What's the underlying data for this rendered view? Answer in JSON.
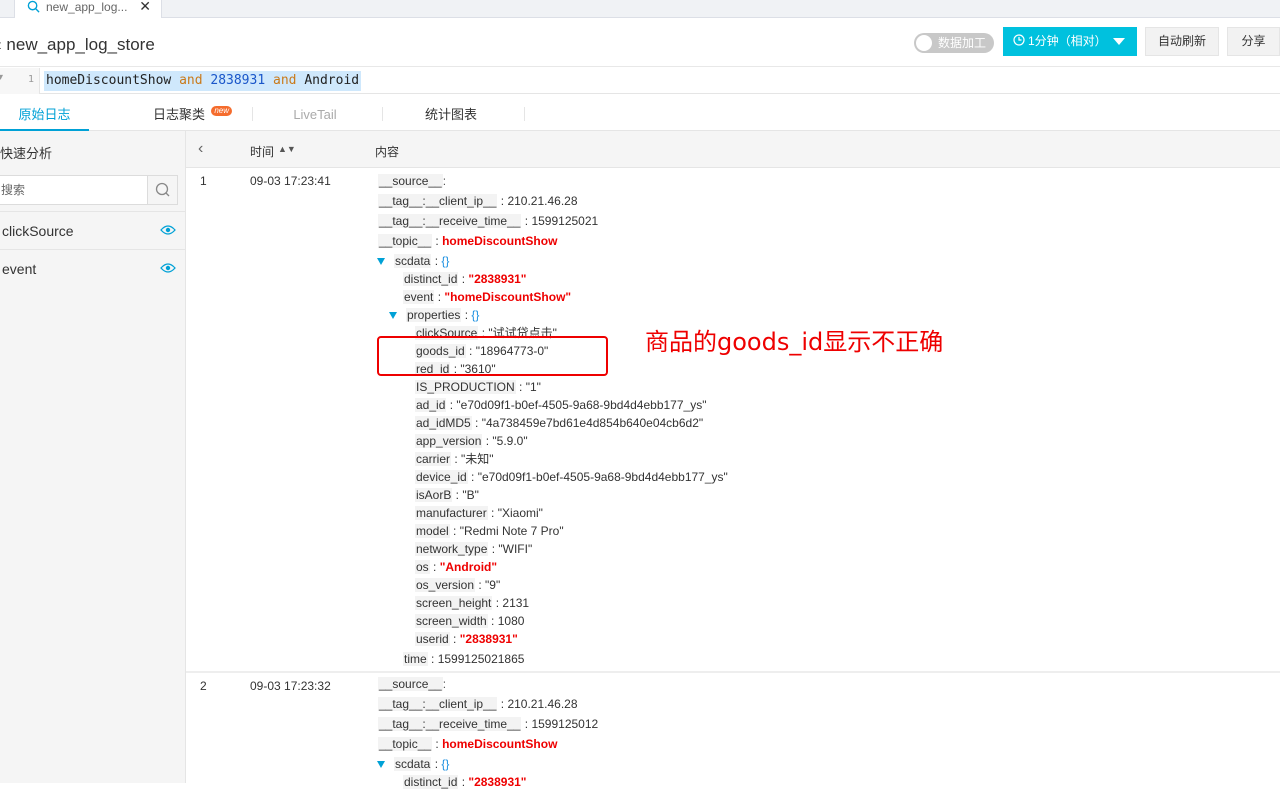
{
  "tab": {
    "label": "new_app_log...",
    "close": "✕"
  },
  "header": {
    "store_name": "new_app_log_store",
    "back": "‹"
  },
  "toolbar": {
    "data_process_label": "数据加工",
    "time_label": "1分钟（相对）",
    "auto_refresh_label": "自动刷新",
    "share_label": "分享"
  },
  "query": {
    "line_number": "1",
    "fold": "▾",
    "tokens": [
      "homeDiscountShow",
      "and",
      "2838931",
      "and",
      "Android"
    ]
  },
  "result_tabs": [
    {
      "label": "原始日志"
    },
    {
      "label": "日志聚类",
      "badge": "new"
    },
    {
      "label": "LiveTail"
    },
    {
      "label": "统计图表"
    }
  ],
  "sidebar": {
    "title": "快速分析",
    "search_placeholder": "搜索",
    "fields": [
      "clickSource",
      "event"
    ]
  },
  "table": {
    "collapse_icon": "‹",
    "col_time": "时间",
    "sort": "▲▼",
    "col_content": "内容"
  },
  "logs": [
    {
      "index": "1",
      "time": "09-03 17:23:41",
      "source": ":",
      "client_ip": "210.21.46.28",
      "receive_time": "1599125021",
      "topic": "homeDiscountShow",
      "scdata_brace": "{}",
      "distinct_id": "\"2838931\"",
      "event": "\"homeDiscountShow\"",
      "properties_brace": "{}",
      "properties": [
        {
          "k": "clickSource",
          "v": "\"试试贷点击\""
        },
        {
          "k": "goods_id",
          "v": "\"18964773-0\""
        },
        {
          "k": "red_id",
          "v": "\"3610\""
        },
        {
          "k": "IS_PRODUCTION",
          "v": "\"1\""
        },
        {
          "k": "ad_id",
          "v": "\"e70d09f1-b0ef-4505-9a68-9bd4d4ebb177_ys\""
        },
        {
          "k": "ad_idMD5",
          "v": "\"4a738459e7bd61e4d854b640e04cb6d2\""
        },
        {
          "k": "app_version",
          "v": "\"5.9.0\""
        },
        {
          "k": "carrier",
          "v": "\"未知\""
        },
        {
          "k": "device_id",
          "v": "\"e70d09f1-b0ef-4505-9a68-9bd4d4ebb177_ys\""
        },
        {
          "k": "isAorB",
          "v": "\"B\""
        },
        {
          "k": "manufacturer",
          "v": "\"Xiaomi\""
        },
        {
          "k": "model",
          "v": "\"Redmi Note 7 Pro\""
        },
        {
          "k": "network_type",
          "v": "\"WIFI\""
        },
        {
          "k": "os",
          "v": "\"Android\"",
          "highlight": true
        },
        {
          "k": "os_version",
          "v": "\"9\""
        },
        {
          "k": "screen_height",
          "v": "2131"
        },
        {
          "k": "screen_width",
          "v": "1080"
        },
        {
          "k": "userid",
          "v": "\"2838931\"",
          "highlight": true
        }
      ],
      "time_field": "1599125021865"
    },
    {
      "index": "2",
      "time": "09-03 17:23:32",
      "source": ":",
      "client_ip": "210.21.46.28",
      "receive_time": "1599125012",
      "topic": "homeDiscountShow",
      "scdata_brace": "{}",
      "distinct_id": "\"2838931\""
    }
  ],
  "keys": {
    "source": "__source__",
    "client_ip": "__tag__:__client_ip__",
    "receive_time": "__tag__:__receive_time__",
    "topic": "__topic__",
    "scdata": "scdata",
    "distinct_id": "distinct_id",
    "event": "event",
    "properties": "properties",
    "time": "time"
  },
  "annotation": "商品的goods_id显示不正确",
  "colors": {
    "accent": "#00c1de",
    "highlight": "#ee0000"
  }
}
